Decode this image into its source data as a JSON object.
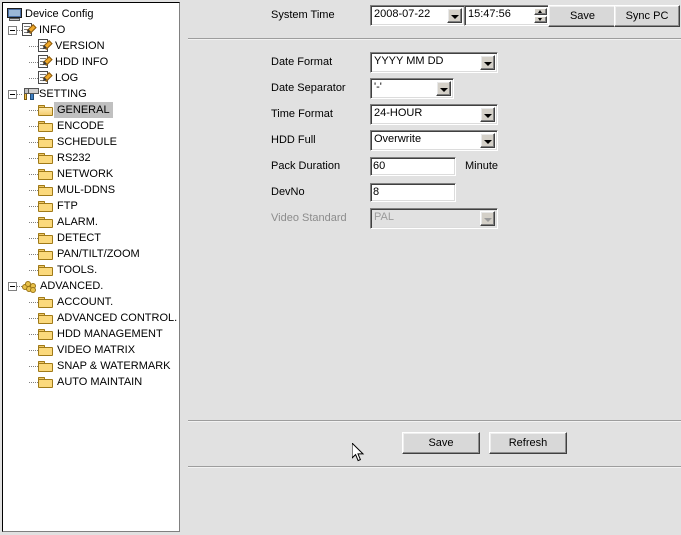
{
  "tree": {
    "root": {
      "label": "Device Config",
      "icon": "monitor-icon"
    },
    "groups": [
      {
        "label": "INFO",
        "icon": "document-pencil-icon",
        "expanded": true,
        "children": [
          {
            "label": "VERSION",
            "icon": "document-pencil-icon"
          },
          {
            "label": "HDD INFO",
            "icon": "document-pencil-icon"
          },
          {
            "label": "LOG",
            "icon": "document-pencil-icon"
          }
        ]
      },
      {
        "label": "SETTING",
        "icon": "tools-icon",
        "expanded": true,
        "children": [
          {
            "label": "GENERAL",
            "icon": "folder-open-icon",
            "selected": true
          },
          {
            "label": "ENCODE",
            "icon": "folder-icon"
          },
          {
            "label": "SCHEDULE",
            "icon": "folder-icon"
          },
          {
            "label": "RS232",
            "icon": "folder-icon"
          },
          {
            "label": "NETWORK",
            "icon": "folder-icon"
          },
          {
            "label": "MUL-DDNS",
            "icon": "folder-icon"
          },
          {
            "label": "FTP",
            "icon": "folder-icon"
          },
          {
            "label": "ALARM.",
            "icon": "folder-icon"
          },
          {
            "label": "DETECT",
            "icon": "folder-icon"
          },
          {
            "label": "PAN/TILT/ZOOM",
            "icon": "folder-icon"
          },
          {
            "label": "TOOLS.",
            "icon": "folder-icon"
          }
        ]
      },
      {
        "label": "ADVANCED.",
        "icon": "gold-coins-icon",
        "expanded": true,
        "children": [
          {
            "label": "ACCOUNT.",
            "icon": "folder-icon"
          },
          {
            "label": "ADVANCED CONTROL.",
            "icon": "folder-icon"
          },
          {
            "label": "HDD MANAGEMENT",
            "icon": "folder-icon"
          },
          {
            "label": "VIDEO MATRIX",
            "icon": "folder-icon"
          },
          {
            "label": "SNAP & WATERMARK",
            "icon": "folder-icon"
          },
          {
            "label": "AUTO MAINTAIN",
            "icon": "folder-icon"
          }
        ]
      }
    ]
  },
  "system_time": {
    "label": "System Time",
    "date_value": "2008-07-22",
    "time_value": "15:47:56",
    "save_label": "Save",
    "sync_pc_label": "Sync PC"
  },
  "form": {
    "date_format": {
      "label": "Date Format",
      "value": "YYYY MM DD"
    },
    "date_separator": {
      "label": "Date Separator",
      "value": "'-'"
    },
    "time_format": {
      "label": "Time Format",
      "value": "24-HOUR"
    },
    "hdd_full": {
      "label": "HDD Full",
      "value": "Overwrite"
    },
    "pack_duration": {
      "label": "Pack Duration",
      "value": "60",
      "unit": "Minute"
    },
    "dev_no": {
      "label": "DevNo",
      "value": "8"
    },
    "video_standard": {
      "label": "Video Standard",
      "value": "PAL",
      "disabled": true
    }
  },
  "footer": {
    "save_label": "Save",
    "refresh_label": "Refresh"
  },
  "colors": {
    "panel_bg": "#e1e1e1",
    "tree_bg": "#ffffff",
    "selection": "#c0c0c0",
    "folder": "#fbd97c",
    "disabled_text": "#9b9b9b"
  }
}
